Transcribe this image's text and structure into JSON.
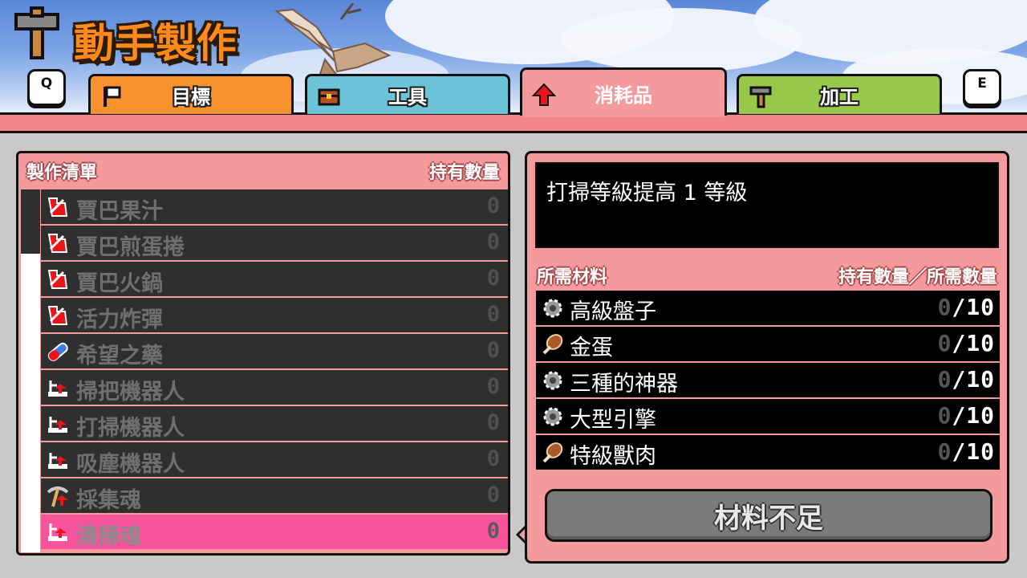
{
  "header": {
    "title": "動手製作",
    "prev_key": "Q",
    "next_key": "E"
  },
  "tabs": [
    {
      "label": "目標",
      "icon": "flag-icon",
      "color": "#f7922f",
      "active": false
    },
    {
      "label": "工具",
      "icon": "chest-icon",
      "color": "#6cc3d7",
      "active": false
    },
    {
      "label": "消耗品",
      "icon": "red-arrow-up-icon",
      "color": "#f49a9c",
      "active": true
    },
    {
      "label": "加工",
      "icon": "hammer-icon",
      "color": "#98c84a",
      "active": false
    }
  ],
  "craft_list": {
    "header_left": "製作清單",
    "header_right": "持有數量",
    "items": [
      {
        "name": "賈巴果汁",
        "count": "0",
        "icon": "consumable-red-icon",
        "selected": false
      },
      {
        "name": "賈巴煎蛋捲",
        "count": "0",
        "icon": "consumable-red-icon",
        "selected": false
      },
      {
        "name": "賈巴火鍋",
        "count": "0",
        "icon": "consumable-red-icon",
        "selected": false
      },
      {
        "name": "活力炸彈",
        "count": "0",
        "icon": "consumable-red-icon",
        "selected": false
      },
      {
        "name": "希望之藥",
        "count": "0",
        "icon": "capsule-icon",
        "selected": false
      },
      {
        "name": "掃把機器人",
        "count": "0",
        "icon": "broom-robot-icon",
        "selected": false
      },
      {
        "name": "打掃機器人",
        "count": "0",
        "icon": "broom-robot-icon",
        "selected": false
      },
      {
        "name": "吸塵機器人",
        "count": "0",
        "icon": "broom-robot-icon",
        "selected": false
      },
      {
        "name": "採集魂",
        "count": "0",
        "icon": "pickaxe-soul-icon",
        "selected": false
      },
      {
        "name": "清掃魂",
        "count": "0",
        "icon": "broom-soul-icon",
        "selected": true
      }
    ]
  },
  "detail": {
    "description": "打掃等級提高 1 等級",
    "materials_header_left": "所需材料",
    "materials_header_right": "持有數量／所需數量",
    "materials": [
      {
        "name": "高級盤子",
        "have": "0",
        "need": "/10",
        "icon": "gear-part-icon"
      },
      {
        "name": "金蛋",
        "have": "0",
        "need": "/10",
        "icon": "meat-icon"
      },
      {
        "name": "三種的神器",
        "have": "0",
        "need": "/10",
        "icon": "gear-part-icon"
      },
      {
        "name": "大型引擎",
        "have": "0",
        "need": "/10",
        "icon": "gear-part-icon"
      },
      {
        "name": "特級獸肉",
        "have": "0",
        "need": "/10",
        "icon": "meat-icon"
      }
    ],
    "craft_button": "材料不足"
  }
}
